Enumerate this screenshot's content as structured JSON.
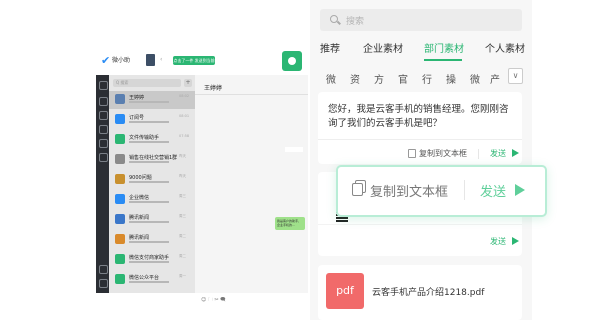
{
  "app": {
    "name": "微小助",
    "tip": "点击了一件 发送到当前会话",
    "list_search_placeholder": "Q 搜索",
    "list_plus": "+",
    "conversation_title": "王婷婷",
    "green_message": "我是客户的助手，企业手机的...",
    "toolbar": "☺ 🗀 ✂ 🗨",
    "chats": [
      {
        "name": "王婷婷",
        "time": "08:02",
        "color": "#5a7fb0"
      },
      {
        "name": "订阅号",
        "time": "08:01",
        "color": "#2a8cf4"
      },
      {
        "name": "文件传输助手",
        "time": "07:58",
        "color": "#2bb673"
      },
      {
        "name": "销售在线社交营销1群",
        "time": "昨天",
        "color": "#8a8a8a"
      },
      {
        "name": "9000问题",
        "time": "昨天",
        "color": "#c8902e"
      },
      {
        "name": "企业微信",
        "time": "周三",
        "color": "#2a8cf4"
      },
      {
        "name": "腾讯新闻",
        "time": "周三",
        "color": "#3b77c9"
      },
      {
        "name": "腾讯新闻",
        "time": "周二",
        "color": "#d98a2b"
      },
      {
        "name": "微信支付商家助手",
        "time": "周二",
        "color": "#2bb673"
      },
      {
        "name": "微信公众平台",
        "time": "周一",
        "color": "#2bb673"
      }
    ]
  },
  "panel": {
    "search_placeholder": "搜索",
    "tabs": [
      "推荐",
      "企业素材",
      "部门素材",
      "个人素材"
    ],
    "active_tab": "部门素材",
    "categories": [
      "微",
      "资",
      "方",
      "官",
      "行",
      "操",
      "微",
      "产"
    ],
    "more": "∨",
    "card1": {
      "text": "您好，我是云客手机的销售经理。您刚刚咨询了我们的云客手机是吧？",
      "copy": "复制到文本框",
      "send": "发送"
    },
    "card2": {
      "send": "发送"
    },
    "card3": {
      "file_type": "pdf",
      "file_name": "云客手机产品介绍1218.pdf"
    },
    "popup": {
      "copy": "复制到文本框",
      "send": "发送"
    }
  },
  "colors": {
    "accent": "#2bb673",
    "sidebar_dark": "#2b2e34",
    "pdf_red": "#f16a6a"
  }
}
